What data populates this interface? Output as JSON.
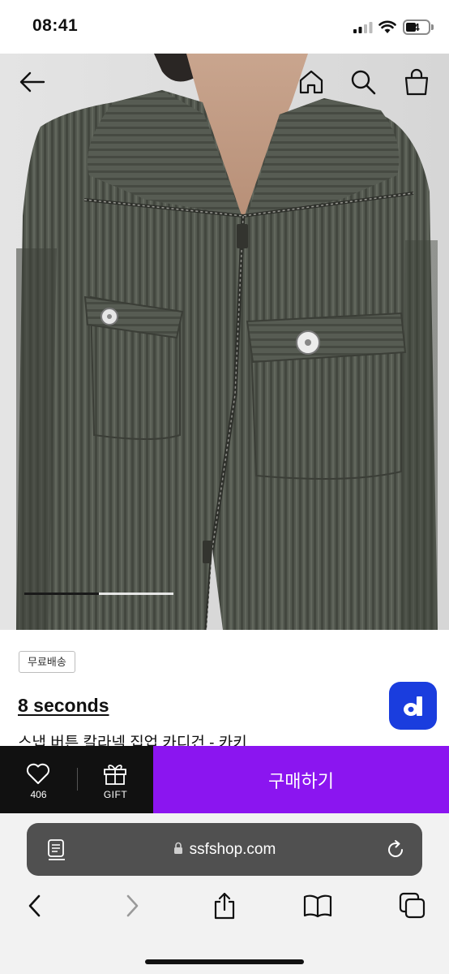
{
  "status_bar": {
    "time": "08:41",
    "battery": "4",
    "battery_level": 0.4
  },
  "hero": {
    "image_position": 1,
    "image_count": 2,
    "icons": [
      "back-arrow-icon",
      "home-icon",
      "search-icon",
      "shopping-bag-icon"
    ]
  },
  "product": {
    "badge": "무료배송",
    "brand": "8 seconds",
    "name": "스냅 버튼 칼라넥 집업 카디건 - 카키"
  },
  "purchase_bar": {
    "like_count": "406",
    "gift_label": "GIFT",
    "buy_label": "구매하기",
    "buy_color": "#8b15f0"
  },
  "browser": {
    "url": "ssfshop.com"
  },
  "colors": {
    "accent": "#8b15f0",
    "floating_button": "#1a3dde",
    "bar_dark": "#111111"
  }
}
